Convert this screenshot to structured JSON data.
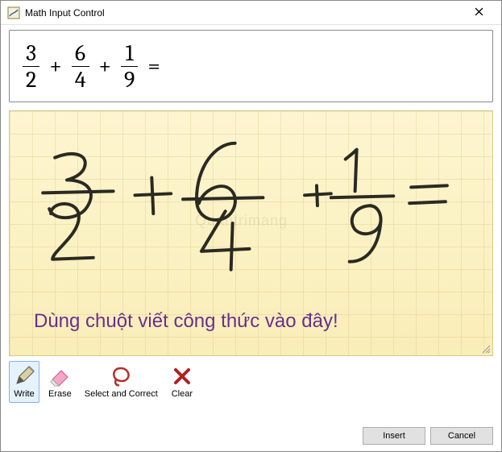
{
  "window": {
    "title": "Math Input Control",
    "close_label": "✕"
  },
  "output": {
    "frac1_num": "3",
    "frac1_den": "2",
    "op1": "+",
    "frac2_num": "6",
    "frac2_den": "4",
    "op2": "+",
    "frac3_num": "1",
    "frac3_den": "9",
    "eq": "="
  },
  "canvas": {
    "caption": "Dùng chuột viết công thức vào đây!",
    "watermark": "Quantrimang"
  },
  "toolbar": {
    "write": "Write",
    "erase": "Erase",
    "select_correct": "Select and Correct",
    "clear": "Clear"
  },
  "footer": {
    "insert": "Insert",
    "cancel": "Cancel"
  }
}
